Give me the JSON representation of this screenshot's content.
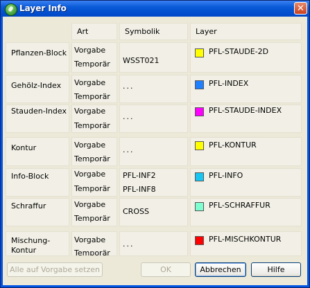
{
  "window": {
    "title": "Layer Info",
    "close_glyph": "✕"
  },
  "headers": {
    "art": "Art",
    "symbolik": "Symbolik",
    "layer": "Layer"
  },
  "rows": [
    {
      "label": "Pflanzen-Block",
      "art1": "Vorgabe",
      "art2": "Temporär",
      "symbolik": "WSST021",
      "layer": "PFL-STAUDE-2D",
      "color": "#ffff00"
    },
    {
      "label": "Gehölz-Index",
      "art1": "Vorgabe",
      "art2": "Temporär",
      "symbolik": "...",
      "layer": "PFL-INDEX",
      "color": "#1e7fff"
    },
    {
      "label": "Stauden-Index",
      "art1": "Vorgabe",
      "art2": "Temporär",
      "symbolik": "...",
      "layer": "PFL-STAUDE-INDEX",
      "color": "#ff00ff"
    },
    {
      "label": "Kontur",
      "art1": "Vorgabe",
      "art2": "Temporär",
      "symbolik": "...",
      "layer": "PFL-KONTUR",
      "color": "#ffff00"
    },
    {
      "label": "Info-Block",
      "art1": "Vorgabe",
      "art2": "Temporär",
      "symbolik": "PFL-INF2",
      "symbolik2": "PFL-INF8",
      "layer": "PFL-INFO",
      "color": "#19c6f2"
    },
    {
      "label": "Schraffur",
      "art1": "Vorgabe",
      "art2": "Temporär",
      "symbolik": "CROSS",
      "layer": "PFL-SCHRAFFUR",
      "color": "#7fffd0"
    },
    {
      "label": "Mischung-",
      "label2": "Kontur",
      "art1": "Vorgabe",
      "art2": "Temporär",
      "symbolik": "...",
      "layer": "PFL-MISCHKONTUR",
      "color": "#ff0000"
    }
  ],
  "buttons": {
    "reset": "Alle auf Vorgabe setzen",
    "ok": "OK",
    "cancel": "Abbrechen",
    "help": "Hilfe"
  }
}
